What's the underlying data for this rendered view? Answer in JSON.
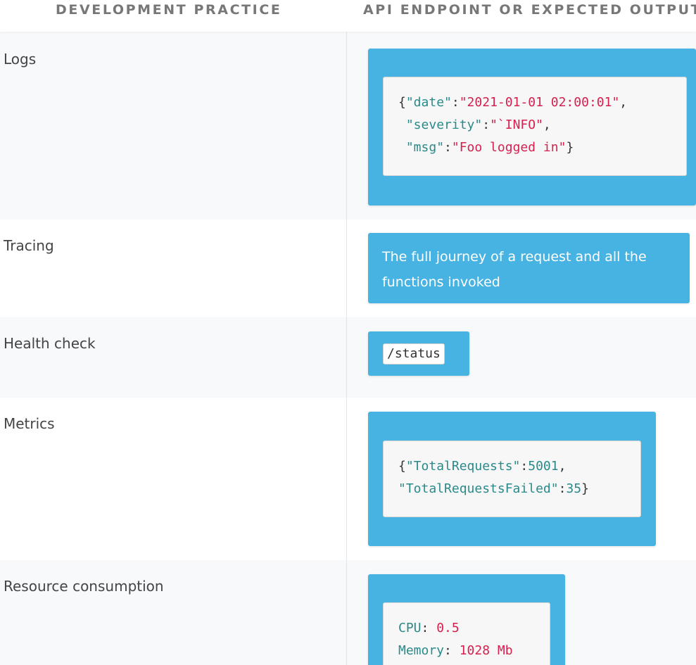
{
  "table": {
    "headers": {
      "practice": "DEVELOPMENT PRACTICE",
      "output": "API ENDPOINT OR EXPECTED OUTPUT"
    },
    "rows": [
      {
        "practice": "Logs",
        "code_lines": [
          [
            {
              "t": "{",
              "c": "punc"
            },
            {
              "t": "\"date\"",
              "c": "key"
            },
            {
              "t": ":",
              "c": "punc"
            },
            {
              "t": "\"2021-01-01 02:00:01\"",
              "c": "str"
            },
            {
              "t": ",",
              "c": "punc"
            }
          ],
          [
            {
              "t": " ",
              "c": "punc"
            },
            {
              "t": "\"severity\"",
              "c": "key"
            },
            {
              "t": ":",
              "c": "punc"
            },
            {
              "t": "\"`INFO\"",
              "c": "str"
            },
            {
              "t": ",",
              "c": "punc"
            }
          ],
          [
            {
              "t": " ",
              "c": "punc"
            },
            {
              "t": "\"msg\"",
              "c": "key"
            },
            {
              "t": ":",
              "c": "punc"
            },
            {
              "t": "\"Foo logged in\"",
              "c": "str"
            },
            {
              "t": "}",
              "c": "punc"
            }
          ]
        ]
      },
      {
        "practice": "Tracing",
        "text": "The full journey of a request and all the functions invoked"
      },
      {
        "practice": "Health check",
        "endpoint": "/status"
      },
      {
        "practice": "Metrics",
        "code_lines": [
          [
            {
              "t": "{",
              "c": "punc"
            },
            {
              "t": "\"TotalRequests\"",
              "c": "key"
            },
            {
              "t": ":",
              "c": "punc"
            },
            {
              "t": "5001",
              "c": "num"
            },
            {
              "t": ",",
              "c": "punc"
            }
          ],
          [
            {
              "t": "\"TotalRequestsFailed\"",
              "c": "key"
            },
            {
              "t": ":",
              "c": "punc"
            },
            {
              "t": "35",
              "c": "num"
            },
            {
              "t": "}",
              "c": "punc"
            }
          ]
        ]
      },
      {
        "practice": "Resource consumption",
        "code_lines": [
          [
            {
              "t": "CPU",
              "c": "key"
            },
            {
              "t": ": ",
              "c": "punc"
            },
            {
              "t": "0.5",
              "c": "str"
            }
          ],
          [
            {
              "t": "Memory",
              "c": "key"
            },
            {
              "t": ": ",
              "c": "punc"
            },
            {
              "t": "1028 Mb",
              "c": "str"
            }
          ]
        ]
      }
    ]
  },
  "colors": {
    "box": "#47b3e2",
    "key": "#2a8a8a",
    "string": "#d6204e",
    "header_text": "#777777"
  }
}
